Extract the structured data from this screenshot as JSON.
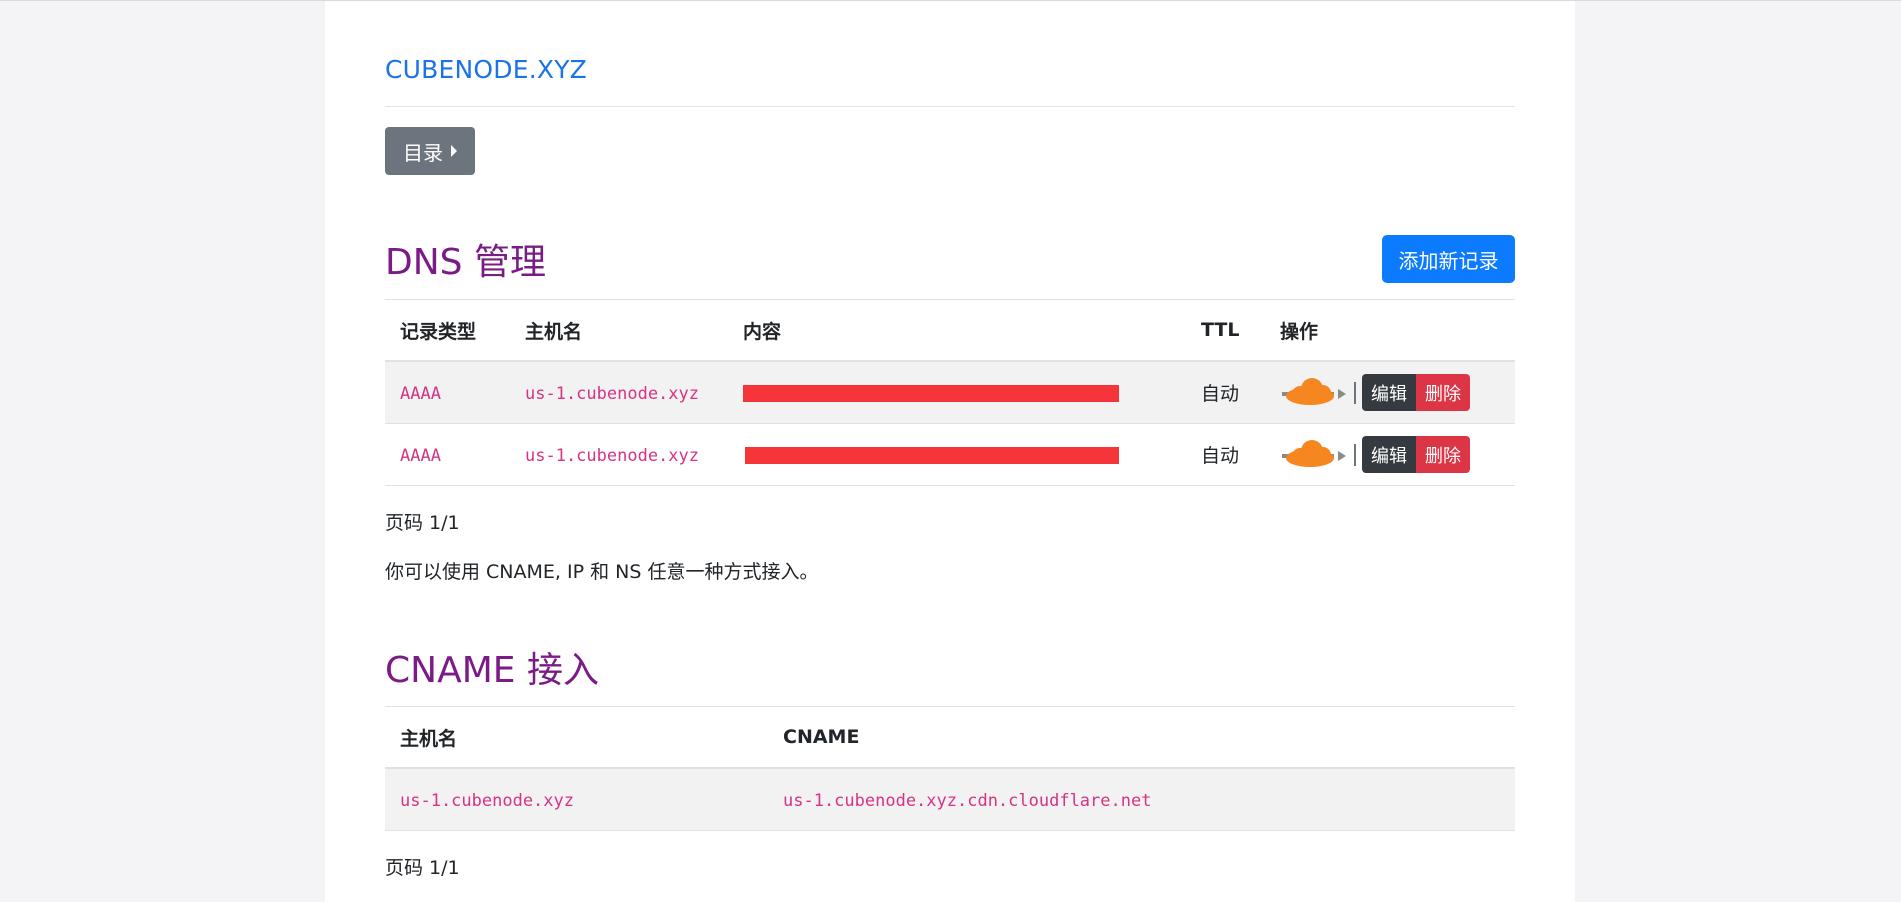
{
  "site": {
    "title": "CUBENODE.XYZ"
  },
  "nav": {
    "directory_label": "目录"
  },
  "dns": {
    "title": "DNS 管理",
    "add_button": "添加新记录",
    "columns": [
      "记录类型",
      "主机名",
      "内容",
      "TTL",
      "操作"
    ],
    "rows": [
      {
        "type": "AAAA",
        "host": "us-1.cubenode.xyz",
        "ttl": "自动",
        "edit": "编辑",
        "delete": "删除"
      },
      {
        "type": "AAAA",
        "host": "us-1.cubenode.xyz",
        "ttl": "自动",
        "edit": "编辑",
        "delete": "删除"
      }
    ],
    "pagination": "页码 1/1",
    "note": "你可以使用 CNAME, IP 和 NS 任意一种方式接入。"
  },
  "cname": {
    "title": "CNAME 接入",
    "columns": [
      "主机名",
      "CNAME"
    ],
    "rows": [
      {
        "host": "us-1.cubenode.xyz",
        "cname": "us-1.cubenode.xyz.cdn.cloudflare.net"
      }
    ],
    "pagination": "页码 1/1"
  },
  "colors": {
    "link": "#1a73e8",
    "section_title": "#7b1b86",
    "primary": "#0d7bff",
    "danger": "#dc3545",
    "dark": "#343a40",
    "secondary": "#6c757d",
    "cloud": "#f6861f",
    "redaction": "#f5353a"
  },
  "icons": {
    "proxy_status": "cloudflare-proxied-cloud-icon",
    "caret": "caret-right-icon"
  }
}
